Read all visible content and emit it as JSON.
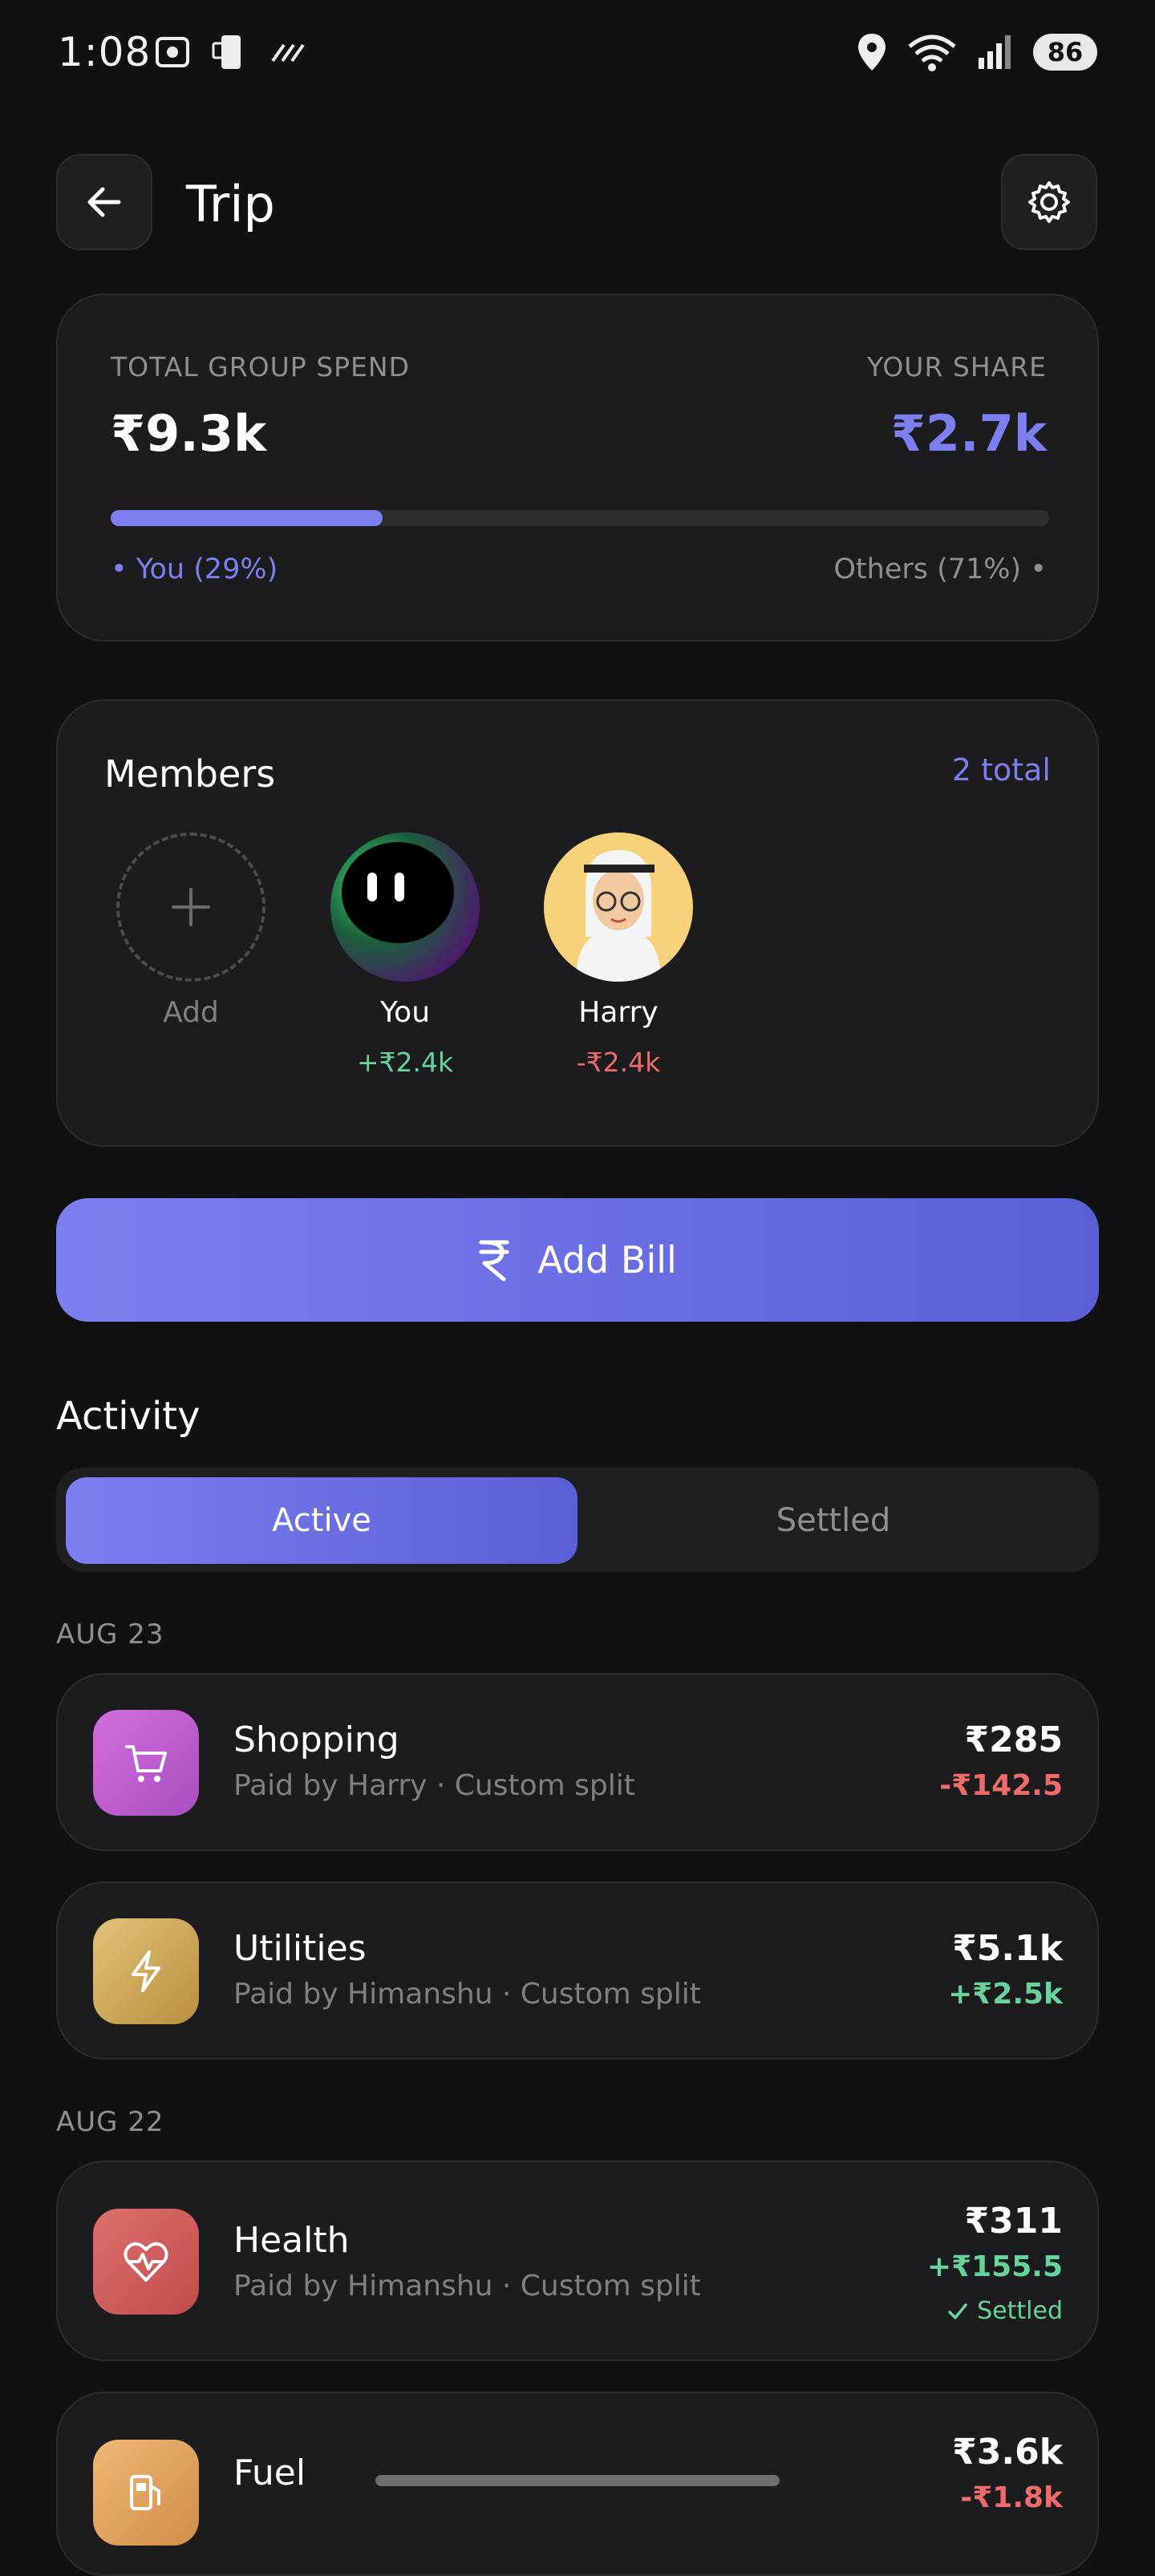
{
  "status_bar": {
    "time": "1:08",
    "battery": "86",
    "signal_label": "5"
  },
  "header": {
    "title": "Trip"
  },
  "summary": {
    "total_label": "TOTAL GROUP SPEND",
    "total_value": "₹9.3k",
    "share_label": "YOUR SHARE",
    "share_value": "₹2.7k",
    "you_pct": 29,
    "you_label": "• You (29%)",
    "others_label": "Others (71%) •"
  },
  "members": {
    "title": "Members",
    "total": "2 total",
    "add_label": "Add",
    "list": [
      {
        "name": "You",
        "balance": "+₹2.4k"
      },
      {
        "name": "Harry",
        "balance": "-₹2.4k"
      }
    ]
  },
  "add_bill": {
    "icon": "rupee-icon",
    "label": "Add Bill"
  },
  "activity": {
    "title": "Activity",
    "tabs": [
      "Active",
      "Settled"
    ],
    "groups": [
      {
        "date": "AUG 23",
        "items": [
          {
            "title": "Shopping",
            "sub": "Paid by Harry · Custom split",
            "amount": "₹285",
            "share": "-₹142.5",
            "icon": "cart-icon",
            "color": "#c85fd0"
          },
          {
            "title": "Utilities",
            "sub": "Paid by Himanshu · Custom split",
            "amount": "₹5.1k",
            "share": "+₹2.5k",
            "icon": "bolt-icon",
            "color": "#c9a24f"
          }
        ]
      },
      {
        "date": "AUG 22",
        "items": [
          {
            "title": "Health",
            "sub": "Paid by Himanshu · Custom split",
            "amount": "₹311",
            "share": "+₹155.5",
            "badge": "Settled",
            "icon": "heart-pulse-icon",
            "color": "#d9605f"
          },
          {
            "title": "Fuel",
            "amount": "₹3.6k",
            "share": "-₹1.8k",
            "icon": "fuel-icon",
            "color": "#e0a460"
          }
        ]
      }
    ]
  }
}
